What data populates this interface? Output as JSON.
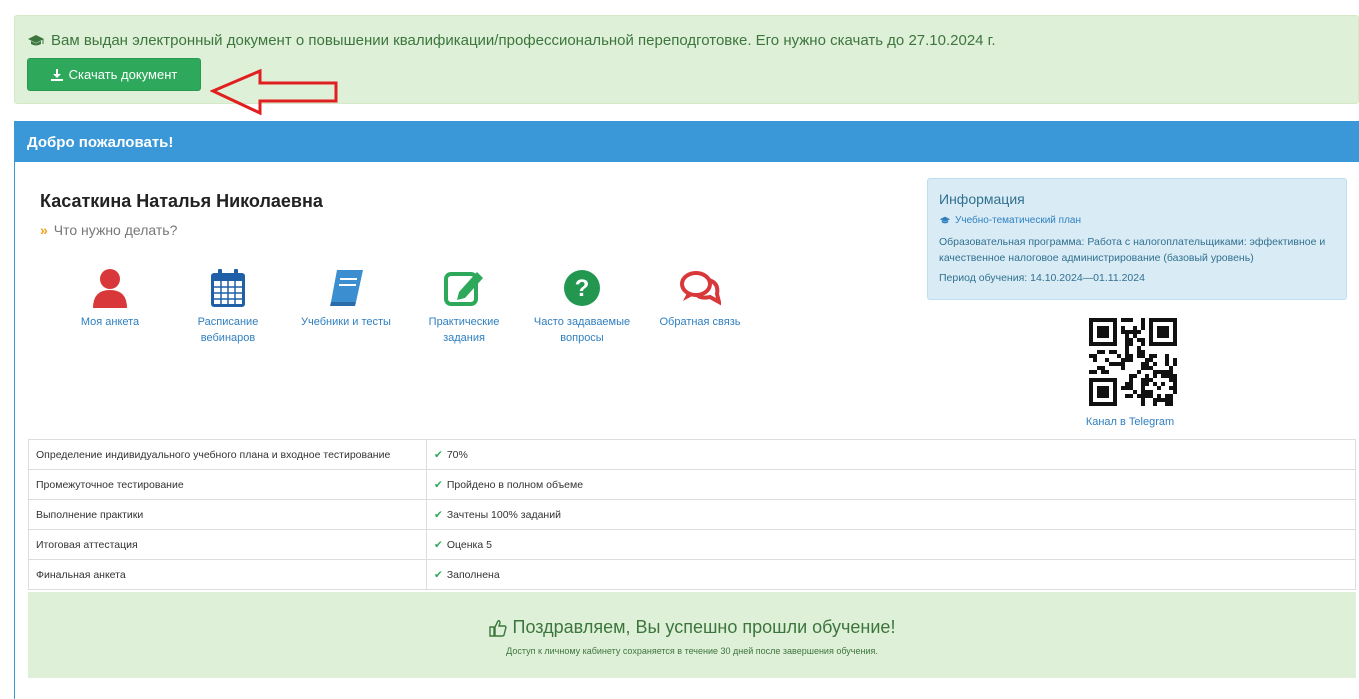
{
  "alert": {
    "message": "Вам выдан электронный документ о повышении квалификации/профессиональной переподготовке. Его нужно скачать до 27.10.2024 г.",
    "download_label": "Скачать документ"
  },
  "panel": {
    "title": "Добро пожаловать!",
    "user_name": "Касаткина Наталья Николаевна",
    "todo_label": "Что нужно делать?"
  },
  "menu": [
    {
      "label": "Моя анкета",
      "icon": "user-icon"
    },
    {
      "label": "Расписание вебинаров",
      "icon": "calendar-icon"
    },
    {
      "label": "Учебники и тесты",
      "icon": "book-icon"
    },
    {
      "label": "Практические задания",
      "icon": "edit-icon"
    },
    {
      "label": "Часто задаваемые вопросы",
      "icon": "question-icon"
    },
    {
      "label": "Обратная связь",
      "icon": "chat-icon"
    }
  ],
  "info": {
    "title": "Информация",
    "plan_link": "Учебно-тематический план",
    "program": "Образовательная программа: Работа с налогоплательщиками: эффективное и качественное налоговое администрирование (базовый уровень)",
    "period": "Период обучения: 14.10.2024—01.11.2024",
    "telegram": "Канал в Telegram"
  },
  "progress": [
    {
      "step": "Определение индивидуального учебного плана и входное тестирование",
      "status": "70%"
    },
    {
      "step": "Промежуточное тестирование",
      "status": "Пройдено в полном объеме"
    },
    {
      "step": "Выполнение практики",
      "status": "Зачтены 100% заданий"
    },
    {
      "step": "Итоговая аттестация",
      "status": "Оценка 5"
    },
    {
      "step": "Финальная анкета",
      "status": "Заполнена"
    }
  ],
  "congrats": {
    "title": "Поздравляем, Вы успешно прошли обучение!",
    "note": "Доступ к личному кабинету сохраняется в течение 30 дней после завершения обучения."
  },
  "colors": {
    "accent_blue": "#3a98d8",
    "success_green": "#2ea95c",
    "alert_bg": "#dff0d8",
    "arrow_red": "#e02020"
  }
}
